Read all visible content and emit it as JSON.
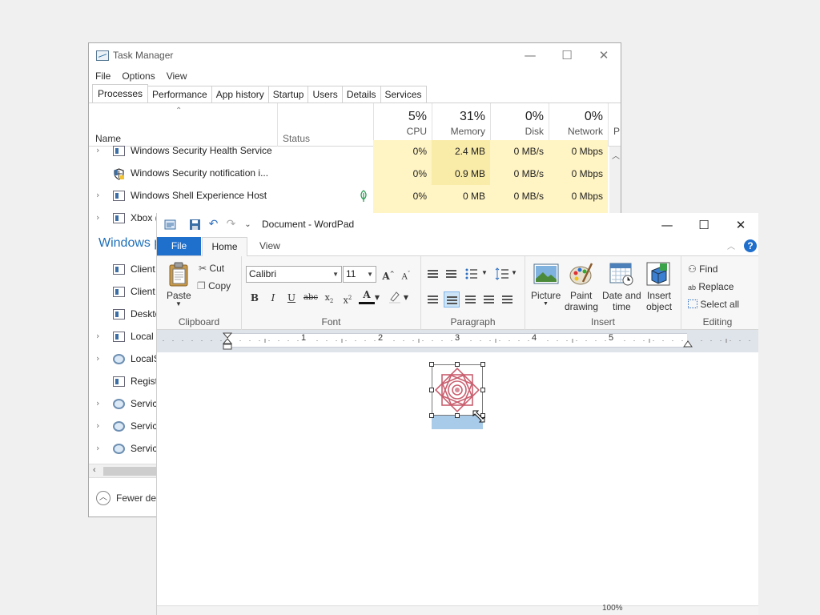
{
  "task_manager": {
    "title": "Task Manager",
    "menu": [
      "File",
      "Options",
      "View"
    ],
    "tabs": [
      "Processes",
      "Performance",
      "App history",
      "Startup",
      "Users",
      "Details",
      "Services"
    ],
    "active_tab": "Processes",
    "columns": {
      "name": "Name",
      "status": "Status",
      "cpu": {
        "pct": "5%",
        "label": "CPU"
      },
      "memory": {
        "pct": "31%",
        "label": "Memory"
      },
      "disk": {
        "pct": "0%",
        "label": "Disk"
      },
      "network": {
        "pct": "0%",
        "label": "Network"
      },
      "power": "P"
    },
    "rows": [
      {
        "name": "Windows Security Health Service",
        "cpu": "0%",
        "memory": "2.4 MB",
        "disk": "0 MB/s",
        "network": "0 Mbps",
        "icon": "service-icon",
        "expandable": true
      },
      {
        "name": "Windows Security notification i...",
        "cpu": "0%",
        "memory": "0.9 MB",
        "disk": "0 MB/s",
        "network": "0 Mbps",
        "icon": "shield-icon",
        "expandable": false
      },
      {
        "name": "Windows Shell Experience Host",
        "cpu": "0%",
        "memory": "0 MB",
        "disk": "0 MB/s",
        "network": "0 Mbps",
        "icon": "service-icon",
        "expandable": true,
        "suspended_leaf": true
      },
      {
        "name": "Xbox (",
        "icon": "service-icon",
        "expandable": true
      }
    ],
    "group_header": "Windows p",
    "partial_rows": [
      {
        "name": "Client",
        "icon": "service-icon",
        "expandable": false
      },
      {
        "name": "Client",
        "icon": "service-icon",
        "expandable": false
      },
      {
        "name": "Deskto",
        "icon": "service-icon",
        "expandable": false
      },
      {
        "name": "Local",
        "icon": "service-icon",
        "expandable": true
      },
      {
        "name": "LocalS",
        "icon": "gear-icon",
        "expandable": true
      },
      {
        "name": "Regist",
        "icon": "service-icon",
        "expandable": false
      },
      {
        "name": "Servic",
        "icon": "gear-icon",
        "expandable": true
      },
      {
        "name": "Servic",
        "icon": "gear-icon",
        "expandable": true
      },
      {
        "name": "Servic",
        "icon": "gear-icon",
        "expandable": true
      }
    ],
    "footer": "Fewer det"
  },
  "wordpad": {
    "title": "Document - WordPad",
    "tabs": {
      "file": "File",
      "home": "Home",
      "view": "View"
    },
    "clipboard": {
      "paste": "Paste",
      "cut": "Cut",
      "copy": "Copy",
      "label": "Clipboard"
    },
    "font": {
      "family": "Calibri",
      "size": "11",
      "label": "Font"
    },
    "paragraph": {
      "label": "Paragraph"
    },
    "insert": {
      "picture": "Picture",
      "paint1": "Paint",
      "paint2": "drawing",
      "dt1": "Date and",
      "dt2": "time",
      "obj1": "Insert",
      "obj2": "object",
      "label": "Insert"
    },
    "editing": {
      "find": "Find",
      "replace": "Replace",
      "select_all": "Select all",
      "label": "Editing"
    },
    "ruler_numbers": [
      "1",
      "2",
      "3",
      "4",
      "5"
    ],
    "zoom": "100%"
  }
}
